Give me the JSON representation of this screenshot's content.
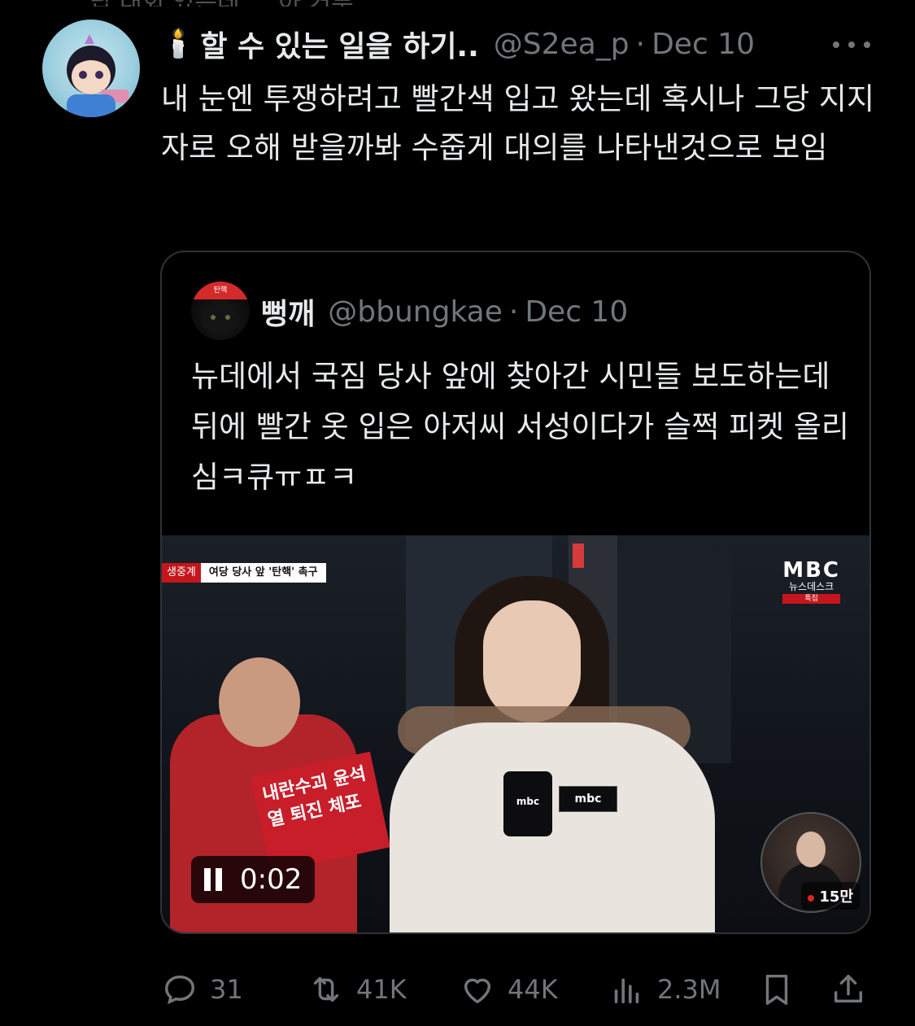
{
  "above_partial_text": "답 대회 였는데 ... 아 거부 ...",
  "tweet": {
    "avatar_label": "",
    "candle_emoji": "🕯️",
    "display_name": "할 수 있는 일을 하기..",
    "handle": "@S2ea_p",
    "separator": "·",
    "date": "Dec 10",
    "text": "내 눈엔 투쟁하려고 빨간색 입고 왔는데 혹시나 그당 지지자로 오해 받을까봐 수줍게 대의를 나타낸것으로 보임"
  },
  "quote": {
    "avatar_badge": "탄핵",
    "display_name": "뻥깨",
    "handle": "@bbungkae",
    "separator": "·",
    "date": "Dec 10",
    "text": "뉴데에서 국짐 당사 앞에 찾아간 시민들 보도하는데 뒤에 빨간 옷 입은 아저씨 서성이다가 슬쩍 피켓 올리심ㅋ큐ㅠㅍㅋ",
    "video": {
      "chyron_live": "생중계",
      "chyron_headline": "여당 당사 앞 '탄핵' 촉구",
      "broadcaster": "MBC",
      "program": "뉴스데스크",
      "program_sub": "특집",
      "mic_logo": "mbc",
      "jacket_logo": "mbc",
      "sign_text": "내란수괴 윤석열 퇴진 체포",
      "viewers": "15만",
      "timestamp": "0:02",
      "playing": true
    }
  },
  "actions": {
    "replies": "31",
    "reposts": "41K",
    "likes": "44K",
    "views": "2.3M"
  },
  "colors": {
    "background": "#000000",
    "text": "#e7e9ea",
    "muted": "#71767b",
    "border": "#2f3336"
  }
}
